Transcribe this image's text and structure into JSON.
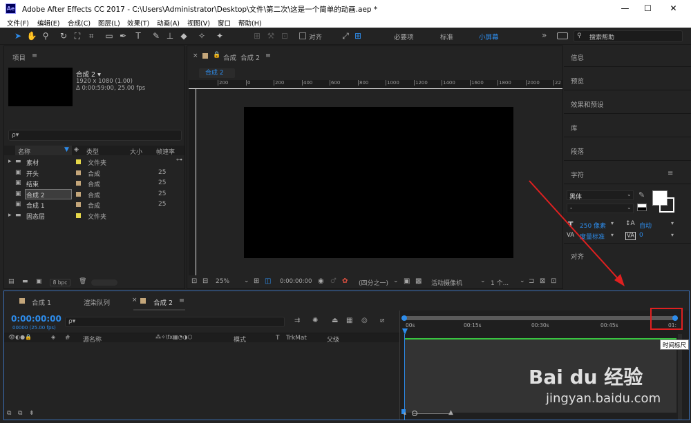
{
  "window": {
    "app_icon": "Ae",
    "title": "Adobe After Effects CC 2017 - C:\\Users\\Administrator\\Desktop\\文件\\第二次\\这是一个简单的动画.aep *",
    "minimize": "—",
    "maximize": "☐",
    "close": "✕"
  },
  "menu": [
    "文件(F)",
    "编辑(E)",
    "合成(C)",
    "图层(L)",
    "效果(T)",
    "动画(A)",
    "视图(V)",
    "窗口",
    "帮助(H)"
  ],
  "toolbar": {
    "align_label": "对齐",
    "workspaces": [
      "必要项",
      "标准",
      "小屏幕"
    ],
    "overflow": "»",
    "search_placeholder": "搜索帮助"
  },
  "project": {
    "title": "项目",
    "menu_icon": "≡",
    "comp_name": "合成 2 ▾",
    "comp_size": "1920 x 1080 (1.00)",
    "comp_duration": "Δ 0:00:59:00, 25.00 fps",
    "search_placeholder": "ρ▾",
    "columns": [
      "名称",
      "类型",
      "大小",
      "帧速率"
    ],
    "items": [
      {
        "name": "素材",
        "type": "文件夹",
        "fps": "",
        "kind": "folder",
        "color": "#e6d84a",
        "expand": "▸"
      },
      {
        "name": "开头",
        "type": "合成",
        "fps": "25",
        "kind": "comp",
        "color": "#c4a67a",
        "expand": ""
      },
      {
        "name": "结束",
        "type": "合成",
        "fps": "25",
        "kind": "comp",
        "color": "#c4a67a",
        "expand": ""
      },
      {
        "name": "合成 2",
        "type": "合成",
        "fps": "25",
        "kind": "comp",
        "color": "#c4a67a",
        "expand": ""
      },
      {
        "name": "合成 1",
        "type": "合成",
        "fps": "25",
        "kind": "comp",
        "color": "#c4a67a",
        "expand": ""
      },
      {
        "name": "固态层",
        "type": "文件夹",
        "fps": "",
        "kind": "folder",
        "color": "#e6d84a",
        "expand": "▸"
      }
    ],
    "bpc": "8 bpc"
  },
  "composition": {
    "tab_label": "合成",
    "tab_name": "合成 2",
    "breadcrumb": "合成 2",
    "ruler_labels": [
      "200",
      "0",
      "200",
      "400",
      "600",
      "800",
      "1000",
      "1200",
      "1400",
      "1600",
      "1800",
      "2000",
      "22"
    ],
    "zoom": "25%",
    "timecode": "0:00:00:00",
    "resolution": "(四分之一)",
    "camera": "活动摄像机",
    "views": "1 个..."
  },
  "right_panels": {
    "items": [
      "信息",
      "预览",
      "效果和预设",
      "库",
      "段落"
    ],
    "character": {
      "title": "字符",
      "font": "黑体",
      "style": "-",
      "font_size": "250 像素",
      "leading": "自动",
      "kerning": "度量标准",
      "tracking": "0"
    },
    "align": "对齐"
  },
  "timeline": {
    "tabs": [
      "合成 1",
      "渲染队列",
      "合成 2"
    ],
    "timecode": "0:00:00:00",
    "frame_info": "00000 (25.00 fps)",
    "search_placeholder": "ρ▾",
    "columns": {
      "source": "源名称",
      "mode": "模式",
      "t": "T",
      "trkmat": "TrkMat",
      "parent": "父级",
      "num": "#"
    },
    "time_labels": [
      "00s",
      "00:15s",
      "00:30s",
      "00:45s",
      "01:"
    ],
    "tooltip": "时间标尺"
  },
  "watermark": {
    "brand": "Bai du 经验",
    "url": "jingyan.baidu.com"
  },
  "colors": {
    "accent": "#2d8ceb",
    "annotation_red": "#e02020",
    "panel_bg": "#232323"
  }
}
